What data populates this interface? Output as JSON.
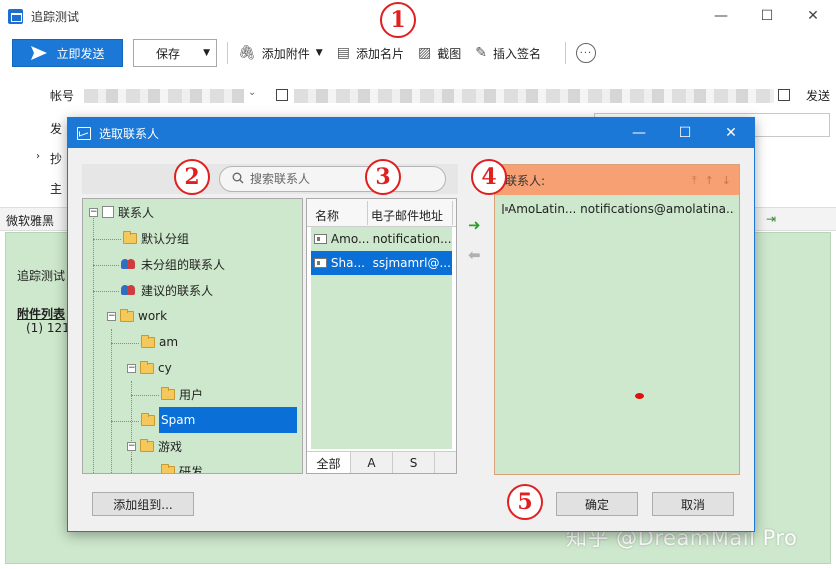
{
  "window": {
    "title": "追踪测试",
    "controls": {
      "minimize": "—",
      "maximize": "☐",
      "close": "✕"
    }
  },
  "toolbar": {
    "send_label": "立即发送",
    "save_label": "保存",
    "attach_label": "添加附件",
    "card_label": "添加名片",
    "screenshot_label": "截图",
    "signature_label": "插入签名",
    "more_label": "···"
  },
  "compose": {
    "account_label": "帐号",
    "send_label_partial": "发送",
    "from_label_partial": "发",
    "cc_label_partial": "抄",
    "subject_label_partial": "主",
    "font_name": "微软雅黑",
    "body_line1": "追踪测试",
    "attach_list_label": "附件列表",
    "attach_item": "(1) 121."
  },
  "dialog": {
    "title": "选取联系人",
    "search_placeholder": "搜索联系人",
    "tree": {
      "root": "联系人",
      "default_group": "默认分组",
      "ungrouped": "未分组的联系人",
      "suggested": "建议的联系人",
      "work": "work",
      "am": "am",
      "cy": "cy",
      "user": "用户",
      "spam": "Spam",
      "games": "游戏",
      "dev": "研发"
    },
    "list": {
      "col_name": "名称",
      "col_email": "电子邮件地址",
      "rows": [
        {
          "name": "Amo...",
          "email": "notification..."
        },
        {
          "name": "Sha...",
          "email": "ssjmamrl@..."
        }
      ],
      "tabs": [
        "全部",
        "A",
        "S"
      ]
    },
    "recipients": {
      "title": "联系人:",
      "rows": [
        {
          "text": "AmoLatin... notifications@amolatina...."
        }
      ]
    },
    "buttons": {
      "add_group": "添加组到...",
      "ok": "确定",
      "cancel": "取消"
    }
  },
  "annotations": [
    "1",
    "2",
    "3",
    "4",
    "5"
  ],
  "watermark": "知乎 @DreamMail Pro",
  "colors": {
    "accent": "#1b78d6",
    "panel_green": "#cde8cc",
    "recipient_header": "#f6a073",
    "annotation_red": "#e02020"
  }
}
